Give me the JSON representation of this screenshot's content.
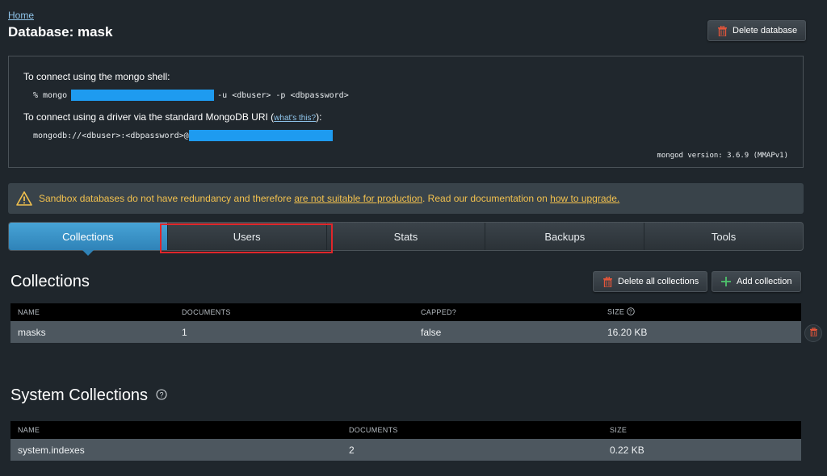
{
  "breadcrumb": {
    "home": "Home"
  },
  "header": {
    "title": "Database: mask",
    "delete_db_label": "Delete database"
  },
  "connect": {
    "shell_intro": "To connect using the mongo shell:",
    "shell_prefix": "% mongo",
    "shell_suffix": "-u <dbuser> -p <dbpassword>",
    "driver_intro": "To connect using a driver via the standard MongoDB URI (",
    "whats_this": "what's this?",
    "driver_intro_end": "):",
    "uri_prefix": "mongodb://<dbuser>:<dbpassword>@",
    "version": "mongod version: 3.6.9 (MMAPv1)"
  },
  "alert": {
    "text_1": "Sandbox databases do not have redundancy and therefore ",
    "link_1": "are not suitable for production",
    "text_2": ". Read our documentation on ",
    "link_2": "how to upgrade."
  },
  "tabs": [
    {
      "label": "Collections"
    },
    {
      "label": "Users"
    },
    {
      "label": "Stats"
    },
    {
      "label": "Backups"
    },
    {
      "label": "Tools"
    }
  ],
  "collections": {
    "title": "Collections",
    "delete_all_label": "Delete all collections",
    "add_label": "Add collection",
    "headers": [
      "NAME",
      "DOCUMENTS",
      "CAPPED?",
      "SIZE"
    ],
    "rows": [
      {
        "name": "masks",
        "documents": "1",
        "capped": "false",
        "size": "16.20 KB"
      }
    ]
  },
  "system_collections": {
    "title": "System Collections",
    "headers": [
      "NAME",
      "DOCUMENTS",
      "SIZE"
    ],
    "rows": [
      {
        "name": "system.indexes",
        "documents": "2",
        "size": "0.22 KB"
      }
    ]
  },
  "colors": {
    "background": "#1f262c",
    "accent_tab": "#2f83b8",
    "warning_text": "#f2c14e",
    "redaction": "#1e9bf0",
    "highlight": "#e0262a",
    "add_icon": "#4ec46c",
    "delete_icon": "#e2553a"
  },
  "icons": {
    "delete": "trash-icon",
    "add": "plus-icon",
    "warning": "warning-icon",
    "help": "help-circle-icon"
  }
}
